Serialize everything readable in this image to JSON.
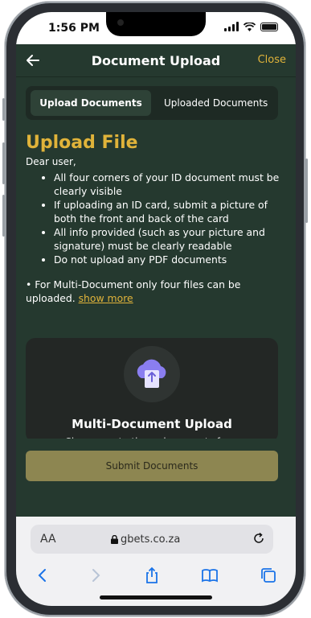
{
  "status": {
    "time": "1:56 PM"
  },
  "header": {
    "title": "Document Upload",
    "close_label": "Close"
  },
  "tabs": [
    {
      "label": "Upload Documents",
      "active": true
    },
    {
      "label": "Uploaded Documents",
      "active": false
    }
  ],
  "content": {
    "heading": "Upload File",
    "greeting": "Dear user,",
    "rules": [
      "All four corners of your ID document must be clearly visible",
      "If uploading an ID card, submit a picture of both the front and back of the card",
      "All info provided (such as your picture and signature) must be clearly readable",
      "Do not upload any PDF documents"
    ],
    "multi_note": "• For Multi-Document only four files can be uploaded.",
    "show_more": "show more"
  },
  "card": {
    "title": "Multi-Document Upload",
    "subtitle": "Choose up to three documents from"
  },
  "submit_label": "Submit Documents",
  "browser": {
    "aa": "AA",
    "url": "gbets.co.za"
  },
  "colors": {
    "accent": "#e0b33a",
    "bg": "#25392f",
    "button": "#8d8651"
  }
}
